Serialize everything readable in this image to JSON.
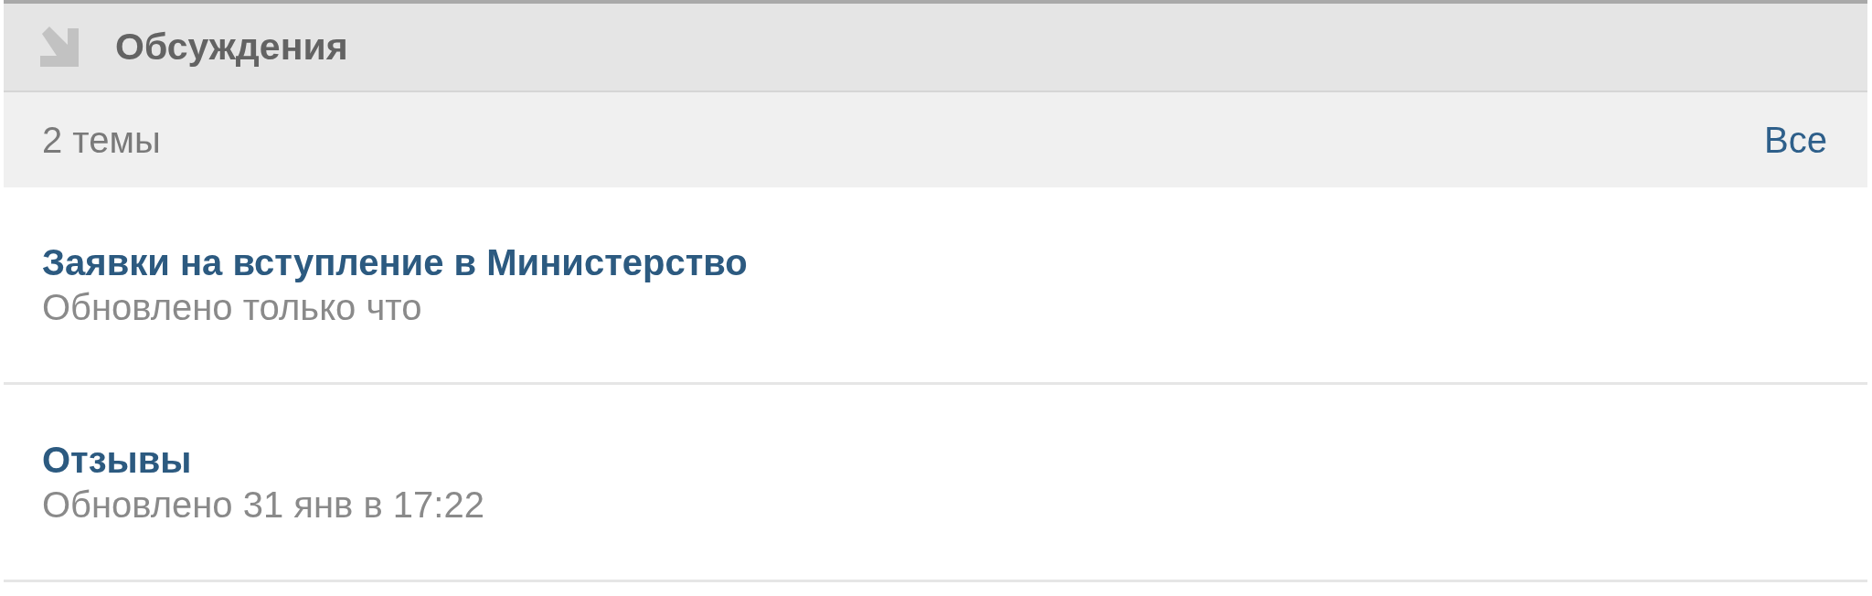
{
  "header": {
    "title": "Обсуждения"
  },
  "summary": {
    "count": "2 темы",
    "link": "Все"
  },
  "topics": [
    {
      "title": "Заявки на вступление в Министерство",
      "updated": "Обновлено только что"
    },
    {
      "title": "Отзывы",
      "updated": "Обновлено 31 янв в 17:22"
    }
  ]
}
